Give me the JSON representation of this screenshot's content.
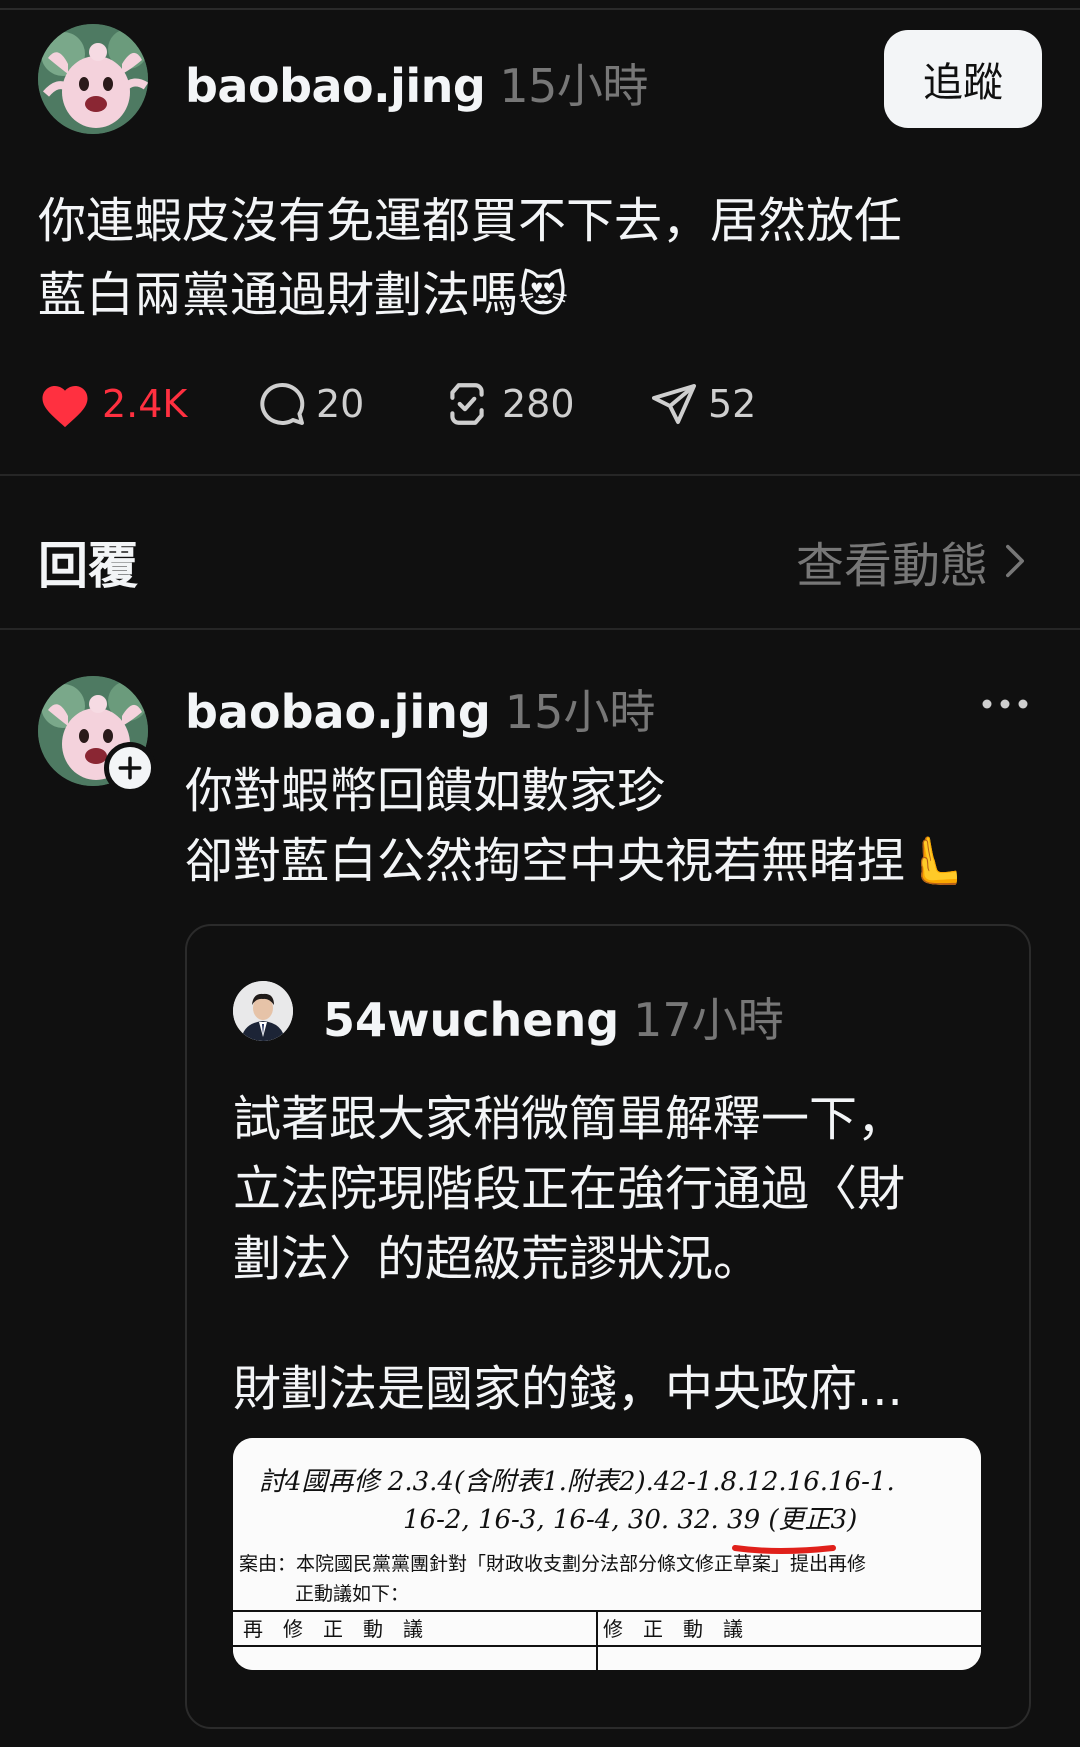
{
  "post": {
    "username": "baobao.jing",
    "time": "15小時",
    "follow_label": "追蹤",
    "text_lines": [
      "你連蝦皮沒有免運都買不下去，居然放任",
      "藍白兩黨通過財劃法嗎😻"
    ],
    "likes": "2.4K",
    "comments": "20",
    "reposts": "280",
    "shares": "52"
  },
  "replies_header": {
    "title": "回覆",
    "view_activity": "查看動態"
  },
  "reply": {
    "username": "baobao.jing",
    "time": "15小時",
    "text_lines": [
      "你對蝦幣回饋如數家珍",
      "卻對藍白公然掏空中央視若無睹捏🫷"
    ],
    "quote": {
      "username": "54wucheng",
      "time": "17小時",
      "text_lines": [
        "試著跟大家稍微簡單解釋一下，",
        "立法院現階段正在強行通過〈財",
        "劃法〉的超級荒謬狀況。"
      ],
      "text_more": "財劃法是國家的錢，中央政府...",
      "image": {
        "line1": "討4國再修 2.3.4(含附表1.附表2).42-1.8.12.16.16-1.",
        "line2": "16-2, 16-3, 16-4, 30. 32. 39 (更正3)",
        "case": "案由：本院國民黨黨團針對「財政收支劃分法部分條文修正草案」提出再修",
        "case2": "正動議如下：",
        "col1": "再　修　正　動　議",
        "col2": "修　正　動　議"
      }
    }
  },
  "colors": {
    "background": "#101010",
    "like": "#ff3040",
    "muted": "#777777"
  }
}
